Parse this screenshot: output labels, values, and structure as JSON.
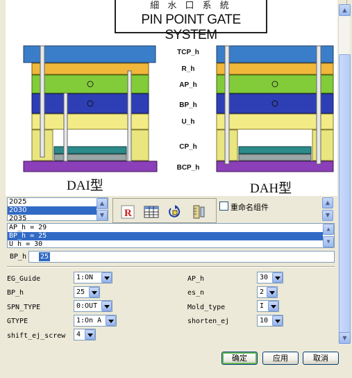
{
  "diagram": {
    "title_cn": "細 水 口 系 統",
    "title_en": "PIN POINT GATE SYSTEM",
    "plate_labels": [
      "TCP_h",
      "R_h",
      "AP_h",
      "BP_h",
      "U_h",
      "CP_h",
      "BCP_h"
    ],
    "caption_left": "DAI型",
    "caption_right": "DAH型",
    "colors": {
      "tcp": "#3a7ec9",
      "r": "#f0b73a",
      "ap": "#82cc3a",
      "bp": "#2e3fb6",
      "u": "#f3eb86",
      "cp": "#e9e680",
      "ejector": "#2c8a8a",
      "bcp": "#8b3fb8"
    }
  },
  "series_list": {
    "items": [
      "2025",
      "2030",
      "2035"
    ],
    "selected": "2030"
  },
  "toolbar": {
    "icons": [
      "insert-R-icon",
      "table-spreadsheet-icon",
      "refresh-rotate-icon",
      "measure-ruler-icon"
    ]
  },
  "rename_component": {
    "label": "重命名组件",
    "checked": false
  },
  "expressions": {
    "items": [
      "AP_h = 29",
      "BP_h = 25",
      "U_h = 30"
    ],
    "selected": "BP_h = 25"
  },
  "expression_edit": {
    "label": "BP_h =",
    "value": "25"
  },
  "params_left": [
    {
      "label": "EG_Guide",
      "value": "1:ON"
    },
    {
      "label": "BP_h",
      "value": "25"
    },
    {
      "label": "SPN_TYPE",
      "value": "0:OUT"
    },
    {
      "label": "GTYPE",
      "value": "1:On A"
    },
    {
      "label": "shift_ej_screw",
      "value": "4"
    }
  ],
  "params_right": [
    {
      "label": "AP_h",
      "value": "30"
    },
    {
      "label": "es_n",
      "value": "2"
    },
    {
      "label": "Mold_type",
      "value": "I"
    },
    {
      "label": "shorten_ej",
      "value": "10"
    }
  ],
  "buttons": {
    "ok": "确定",
    "apply": "应用",
    "cancel": "取消"
  }
}
